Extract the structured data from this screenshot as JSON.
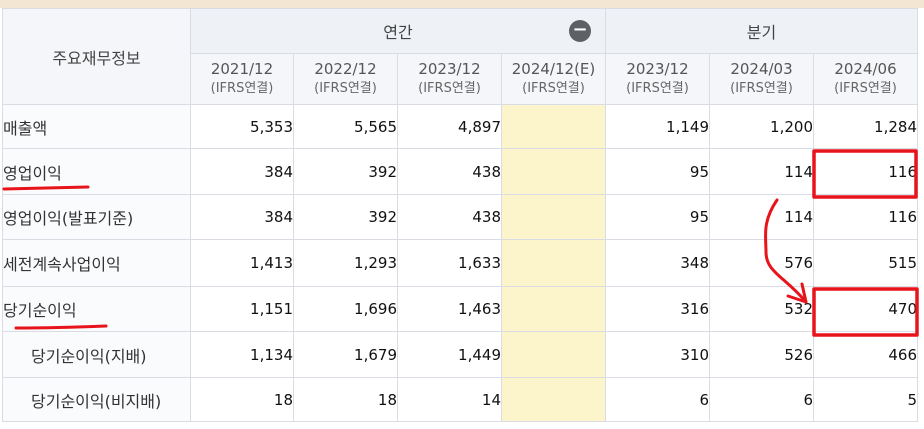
{
  "table": {
    "header_label": "주요재무정보",
    "group_annual": "연간",
    "group_quarter": "분기",
    "collapse_icon_glyph": "−",
    "periods": [
      {
        "period": "2021/12",
        "basis": "(IFRS연결)"
      },
      {
        "period": "2022/12",
        "basis": "(IFRS연결)"
      },
      {
        "period": "2023/12",
        "basis": "(IFRS연결)"
      },
      {
        "period": "2024/12(E)",
        "basis": "(IFRS연결)"
      },
      {
        "period": "2023/12",
        "basis": "(IFRS연결)"
      },
      {
        "period": "2024/03",
        "basis": "(IFRS연결)"
      },
      {
        "period": "2024/06",
        "basis": "(IFRS연결)"
      }
    ],
    "rows": [
      {
        "label": "매출액",
        "values": [
          "5,353",
          "5,565",
          "4,897",
          "",
          "1,149",
          "1,200",
          "1,284"
        ]
      },
      {
        "label": "영업이익",
        "values": [
          "384",
          "392",
          "438",
          "",
          "95",
          "114",
          "116"
        ]
      },
      {
        "label": "영업이익(발표기준)",
        "values": [
          "384",
          "392",
          "438",
          "",
          "95",
          "114",
          "116"
        ]
      },
      {
        "label": "세전계속사업이익",
        "values": [
          "1,413",
          "1,293",
          "1,633",
          "",
          "348",
          "576",
          "515"
        ]
      },
      {
        "label": "당기순이익",
        "values": [
          "1,151",
          "1,696",
          "1,463",
          "",
          "316",
          "532",
          "470"
        ]
      },
      {
        "label": "당기순이익(지배)",
        "values": [
          "1,134",
          "1,679",
          "1,449",
          "",
          "310",
          "526",
          "466"
        ]
      },
      {
        "label": "당기순이익(비지배)",
        "values": [
          "18",
          "18",
          "14",
          "",
          "6",
          "6",
          "5"
        ]
      }
    ]
  },
  "annotation": {
    "color": "#e8141b",
    "highlighted_rows": [
      "영업이익",
      "당기순이익"
    ],
    "highlighted_values": [
      "116",
      "470"
    ]
  }
}
